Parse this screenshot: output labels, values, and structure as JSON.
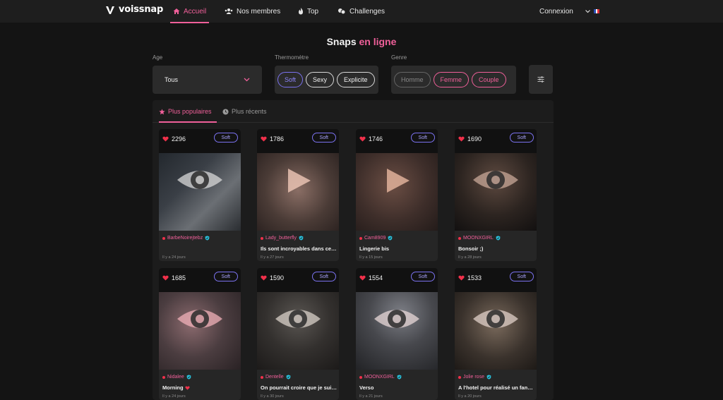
{
  "nav": {
    "brand": "voissnap",
    "items": [
      {
        "label": "Accueil",
        "icon": "home-icon"
      },
      {
        "label": "Nos membres",
        "icon": "users-icon"
      },
      {
        "label": "Top",
        "icon": "flame-icon"
      },
      {
        "label": "Challenges",
        "icon": "challenge-icon"
      }
    ],
    "login": "Connexion",
    "language_flag": "fr-flag-icon"
  },
  "title": {
    "main": "Snaps",
    "accent": "en ligne"
  },
  "filters": {
    "age": {
      "label": "Age",
      "value": "Tous"
    },
    "thermometer": {
      "label": "Thermomètre",
      "options": [
        "Soft",
        "Sexy",
        "Explicite"
      ]
    },
    "genre": {
      "label": "Genre",
      "options": [
        "Homme",
        "Femme",
        "Couple"
      ]
    }
  },
  "tabs": {
    "popular": "Plus populaires",
    "recent": "Plus récents"
  },
  "cards": [
    {
      "likes": "2296",
      "level": "Soft",
      "author": "BarbeNoirejtebz",
      "caption": "",
      "age": "Il y a 24 jours"
    },
    {
      "likes": "1786",
      "level": "Soft",
      "author": "Lady_butterfly",
      "caption": "Ils sont incroyables dans ce soutien-gorge",
      "age": "Il y a 27 jours"
    },
    {
      "likes": "1746",
      "level": "Soft",
      "author": "Cam8909",
      "caption": "Lingerie bis",
      "age": "Il y a 15 jours"
    },
    {
      "likes": "1690",
      "level": "Soft",
      "author": "MOONXGIRL",
      "caption": "Bonsoir ;)",
      "age": "Il y a 28 jours"
    },
    {
      "likes": "1685",
      "level": "Soft",
      "author": "Nidalee",
      "caption": "Morning",
      "age": "Il y a 24 jours"
    },
    {
      "likes": "1590",
      "level": "Soft",
      "author": "Dentelle",
      "caption": "On pourrait croire que je suis sage",
      "age": "Il y a 30 jours"
    },
    {
      "likes": "1554",
      "level": "Soft",
      "author": "MOONXGIRL",
      "caption": "Verso",
      "age": "Il y a 21 jours"
    },
    {
      "likes": "1533",
      "level": "Soft",
      "author": "Jolie rose",
      "caption": "A l'hotel pour réalisé un fantasme",
      "age": "Il y a 20 jours"
    }
  ],
  "colors": {
    "accent": "#f0609a",
    "soft": "#7b72f0",
    "background": "#141414",
    "verified": "#28c4e0"
  }
}
